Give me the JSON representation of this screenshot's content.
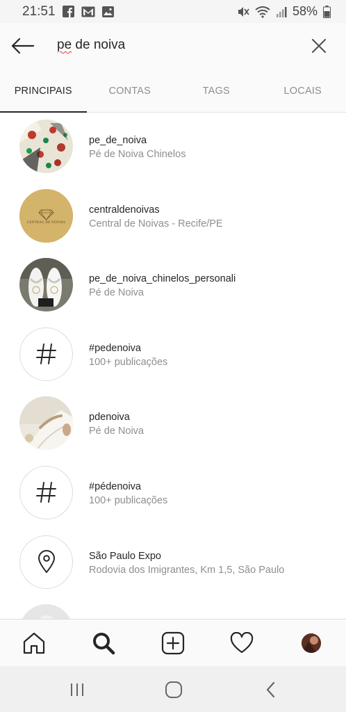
{
  "status_bar": {
    "time": "21:51",
    "battery": "58%",
    "icons": [
      "facebook-icon",
      "gmail-icon",
      "gallery-icon",
      "mute-icon",
      "wifi-icon",
      "signal-icon",
      "battery-icon"
    ]
  },
  "search": {
    "query_misspelled": "pe",
    "query_rest": " de noiva"
  },
  "tabs": [
    {
      "label": "PRINCIPAIS",
      "active": true
    },
    {
      "label": "CONTAS",
      "active": false
    },
    {
      "label": "TAGS",
      "active": false
    },
    {
      "label": "LOCAIS",
      "active": false
    }
  ],
  "results": [
    {
      "title": "pe_de_noiva",
      "subtitle": "Pé de Noiva Chinelos",
      "kind": "account",
      "icon": "floral-avatar"
    },
    {
      "title": "centraldenoivas",
      "subtitle": "Central de Noivas - Recife/PE",
      "kind": "account",
      "icon": "gold-logo-avatar",
      "logo_text": "CENTRAL DE NOIVAS"
    },
    {
      "title": "pe_de_noiva_chinelos_personali",
      "subtitle": "Pé de Noiva",
      "kind": "account",
      "icon": "sandals-avatar"
    },
    {
      "title": "#pedenoiva",
      "subtitle": "100+ publicações",
      "kind": "tag",
      "icon": "hashtag-icon"
    },
    {
      "title": "pdenoiva",
      "subtitle": "Pé de Noiva",
      "kind": "account",
      "icon": "bride-avatar"
    },
    {
      "title": "#pédenoiva",
      "subtitle": "100+ publicações",
      "kind": "tag",
      "icon": "hashtag-icon"
    },
    {
      "title": "São Paulo Expo",
      "subtitle": "Rodovia dos Imigrantes, Km 1,5, São Paulo",
      "kind": "place",
      "icon": "location-pin-icon"
    }
  ],
  "colors": {
    "text_primary": "#262626",
    "text_secondary": "#8e8e8e",
    "gold": "#d4b36a"
  }
}
